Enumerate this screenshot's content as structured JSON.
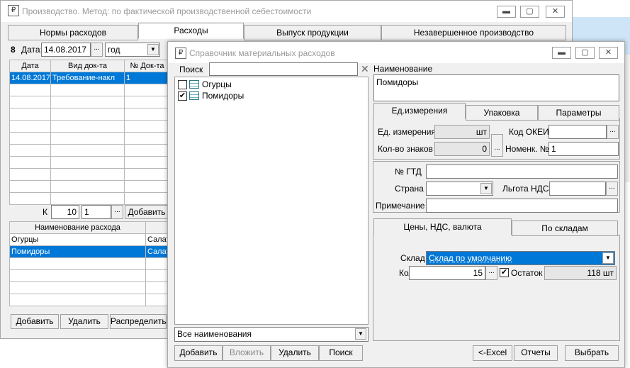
{
  "back": {
    "title": "Производство. Метод: по фактической производственной себестоимости",
    "tabs": [
      "Нормы расходов",
      "Расходы",
      "Выпуск продукции",
      "Незавершенное производство"
    ],
    "num": "8",
    "date_label": "Дата:",
    "date": "14.08.2017",
    "period": "год",
    "doc_cols": [
      "Дата",
      "Вид док-та",
      "№ Док-та"
    ],
    "doc_row": [
      "14.08.2017",
      "Требование-накл",
      "1"
    ],
    "k_label": "К",
    "k_val": "10",
    "k_val2": "1",
    "add_label": "Добавить",
    "exp_col": "Наименование расхода",
    "exp_col2": "",
    "exp_rows": [
      [
        "Огурцы",
        "Салат"
      ],
      [
        "Помидоры",
        "Салат"
      ]
    ],
    "btns": [
      "Добавить",
      "Удалить",
      "Распределить"
    ]
  },
  "dlg": {
    "title": "Справочник материальных расходов",
    "search_label": "Поиск",
    "items": [
      {
        "label": "Огурцы",
        "checked": false
      },
      {
        "label": "Помидоры",
        "checked": true
      }
    ],
    "filter": "Все наименования",
    "left_btns": [
      "Добавить",
      "Вложить",
      "Удалить",
      "Поиск"
    ],
    "name_label": "Наименование",
    "name_val": "Помидоры",
    "tabs1": [
      "Ед.измерения",
      "Упаковка",
      "Параметры"
    ],
    "unit_label": "Ед. измерения",
    "unit_val": "шт",
    "okei_label": "Код ОКЕИ",
    "okei_val": "",
    "digits_label": "Кол-во знаков",
    "digits_val": "0",
    "nomenk_label": "Номенк. №",
    "nomenk_val": "1",
    "gtd_label": "№ ГТД",
    "gtd_val": "",
    "country_label": "Страна",
    "country_val": "",
    "vat_label": "Льгота НДС",
    "vat_val": "",
    "note_label": "Примечание",
    "note_val": "",
    "tabs2": [
      "Цены, НДС, валюта",
      "По складам"
    ],
    "wh_label": "Склад",
    "wh_val": "Склад по умолчанию",
    "qty_label": "Кол-во",
    "qty_val": "15",
    "rest_label": "Остаток",
    "rest_val": "118 шт",
    "bottom_btns": [
      "<-Excel",
      "Отчеты",
      "Выбрать"
    ]
  }
}
